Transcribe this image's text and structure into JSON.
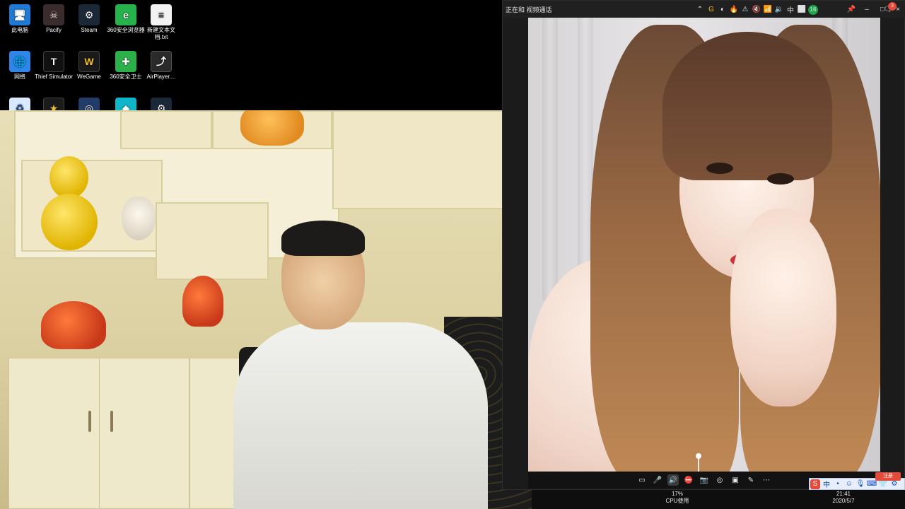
{
  "desktop": {
    "icons": [
      {
        "label": "此电脑",
        "icon": "computer-icon"
      },
      {
        "label": "Pacify",
        "icon": "pacify-icon"
      },
      {
        "label": "Steam",
        "icon": "steam-icon"
      },
      {
        "label": "360安全浏览器",
        "icon": "360-browser-icon"
      },
      {
        "label": "新建文本文档.txt",
        "icon": "text-file-icon"
      },
      {
        "label": "网络",
        "icon": "network-icon"
      },
      {
        "label": "Thief Simulator",
        "icon": "thief-simulator-icon"
      },
      {
        "label": "WeGame",
        "icon": "wegame-icon"
      },
      {
        "label": "360安全卫士",
        "icon": "360-security-icon"
      },
      {
        "label": "AirPlayer....",
        "icon": "airplayer-icon"
      }
    ]
  },
  "call_window": {
    "title": "正在和 视频通话",
    "controls": {
      "pin": "📌",
      "minimize": "–",
      "maximize": "□",
      "close": "×"
    },
    "toolbar_icons": [
      {
        "name": "chat-icon",
        "glyph": "▭"
      },
      {
        "name": "microphone-icon",
        "glyph": "🎤"
      },
      {
        "name": "speaker-icon",
        "glyph": "🔊"
      },
      {
        "name": "camera-off-icon",
        "glyph": "⛔"
      },
      {
        "name": "screenshot-icon",
        "glyph": "📷"
      },
      {
        "name": "effects-icon",
        "glyph": "◎"
      },
      {
        "name": "layout-icon",
        "glyph": "▣"
      },
      {
        "name": "edit-icon",
        "glyph": "✎"
      },
      {
        "name": "more-icon",
        "glyph": "⋯"
      }
    ]
  },
  "taskbar": {
    "cpu_percent": "17%",
    "cpu_label": "CPU使用",
    "clock_time": "21:41",
    "clock_date": "2020/5/7",
    "tray_glyphs": [
      "⌃",
      "G",
      "◐",
      "🔥",
      "⚠",
      "🔇",
      "📶",
      "🔉",
      "中",
      "⬜",
      "16"
    ],
    "notification_count": "3",
    "ime": {
      "label": "中",
      "badge": "注册"
    }
  },
  "colors": {
    "taskbar_bg": "#0e0e0e",
    "window_bg": "#1b1b1b",
    "accent_red": "#e24a3a",
    "ime_blue": "#0a4bb8"
  }
}
